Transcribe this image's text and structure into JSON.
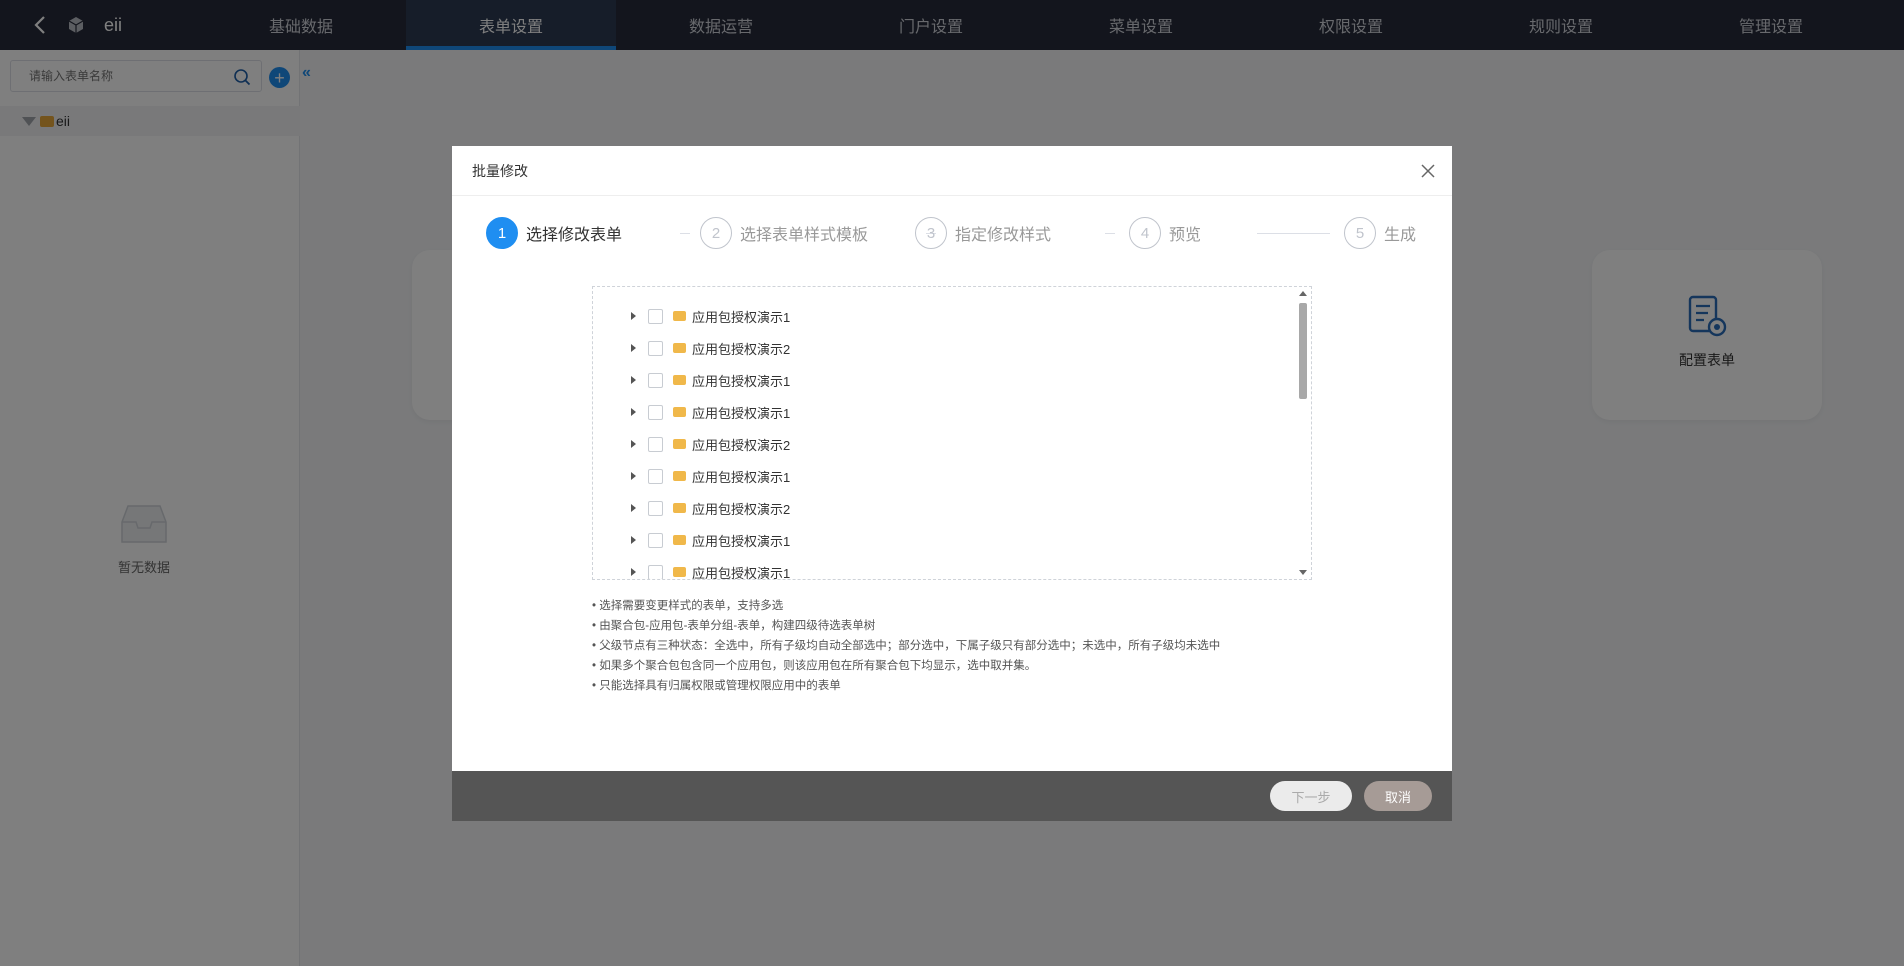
{
  "header": {
    "app_name": "eii",
    "nav": [
      "基础数据",
      "表单设置",
      "数据运营",
      "门户设置",
      "菜单设置",
      "权限设置",
      "规则设置",
      "管理设置"
    ],
    "active_nav": 1
  },
  "sidebar": {
    "search_placeholder": "请输入表单名称",
    "add_label": "+",
    "collapse_label": "«",
    "tree_root": "eii",
    "empty_text": "暂无数据"
  },
  "background": {
    "config_card_label": "配置表单"
  },
  "modal": {
    "title": "批量修改",
    "steps": [
      {
        "num": "1",
        "label": "选择修改表单"
      },
      {
        "num": "2",
        "label": "选择表单样式模板"
      },
      {
        "num": "3",
        "label": "指定修改样式"
      },
      {
        "num": "4",
        "label": "预览"
      },
      {
        "num": "5",
        "label": "生成"
      }
    ],
    "tree_items": [
      "应用包授权演示1",
      "应用包授权演示2",
      "应用包授权演示1",
      "应用包授权演示1",
      "应用包授权演示2",
      "应用包授权演示1",
      "应用包授权演示2",
      "应用包授权演示1",
      "应用包授权演示1"
    ],
    "notes": [
      "选择需要变更样式的表单，支持多选",
      "由聚合包-应用包-表单分组-表单，构建四级待选表单树",
      "父级节点有三种状态：全选中，所有子级均自动全部选中；部分选中，下属子级只有部分选中；未选中，所有子级均未选中",
      "如果多个聚合包包含同一个应用包，则该应用包在所有聚合包下均显示，选中取并集。",
      "只能选择具有归属权限或管理权限应用中的表单"
    ],
    "next_label": "下一步",
    "cancel_label": "取消"
  },
  "colors": {
    "nav_bg": "#262b3a",
    "accent": "#1f8ef1",
    "folder": "#f0b84a",
    "footer_bg": "#555555"
  }
}
